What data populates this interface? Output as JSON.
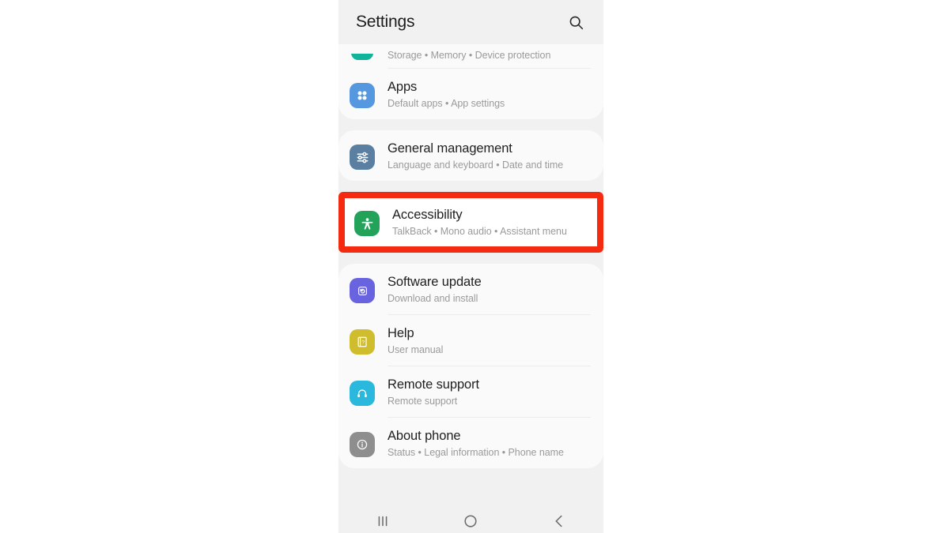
{
  "app": {
    "title": "Settings",
    "search_icon": "search-icon"
  },
  "accent": {
    "highlight": "#f42b10",
    "screen_bg": "#f1f1f1",
    "card_bg": "#fafafa"
  },
  "groups": [
    {
      "name": "device-care-apps-group",
      "rows": [
        {
          "id": "device-care",
          "partial": true,
          "title": "",
          "subtitle": "Storage  •  Memory  •  Device protection",
          "icon": "device-care-icon",
          "icon_color": "#0fb49a"
        },
        {
          "id": "apps",
          "title": "Apps",
          "subtitle": "Default apps  •  App settings",
          "icon": "apps-grid-icon",
          "icon_color": "#5698e0"
        }
      ]
    },
    {
      "name": "general-management-group",
      "rows": [
        {
          "id": "general-management",
          "title": "General management",
          "subtitle": "Language and keyboard  •  Date and time",
          "icon": "sliders-icon",
          "icon_color": "#5b7fa0"
        }
      ]
    },
    {
      "name": "support-group",
      "rows": [
        {
          "id": "software-update",
          "title": "Software update",
          "subtitle": "Download and install",
          "icon": "update-refresh-icon",
          "icon_color": "#6a63e0"
        },
        {
          "id": "help",
          "title": "Help",
          "subtitle": "User manual",
          "icon": "help-book-icon",
          "icon_color": "#cfbd2e"
        },
        {
          "id": "remote-support",
          "title": "Remote support",
          "subtitle": "Remote support",
          "icon": "headset-icon",
          "icon_color": "#2ab8dd"
        },
        {
          "id": "about-phone",
          "title": "About phone",
          "subtitle": "Status  •  Legal information  •  Phone name",
          "icon": "info-icon",
          "icon_color": "#8e8e8e"
        }
      ]
    }
  ],
  "highlighted": {
    "id": "accessibility",
    "title": "Accessibility",
    "subtitle": "TalkBack  •  Mono audio  •  Assistant menu",
    "icon": "accessibility-person-icon",
    "icon_color": "#23a259"
  },
  "navbar": {
    "recents_label": "recents-icon",
    "home_label": "home-icon",
    "back_label": "back-icon"
  }
}
